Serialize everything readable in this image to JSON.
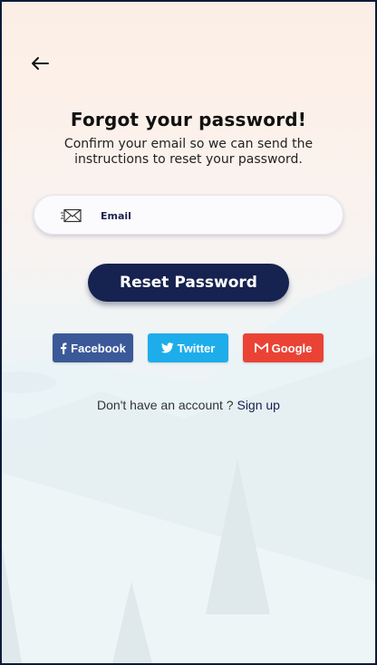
{
  "header": {
    "back_icon": "arrow-left-icon"
  },
  "main": {
    "title": "Forgot your password!",
    "subtitle": "Confirm your email so we can send the instructions to reset your password.",
    "email_field": {
      "icon": "mail-icon",
      "placeholder": "Email",
      "value": ""
    },
    "reset_button_label": "Reset Password"
  },
  "social": {
    "facebook_label": "Facebook",
    "twitter_label": "Twitter",
    "google_label": "Google"
  },
  "footer": {
    "prompt": "Don't have an account ? ",
    "signup_label": "Sign up"
  },
  "colors": {
    "primary": "#16224f",
    "facebook": "#3b5998",
    "twitter": "#1dadea",
    "google": "#ea4335"
  }
}
